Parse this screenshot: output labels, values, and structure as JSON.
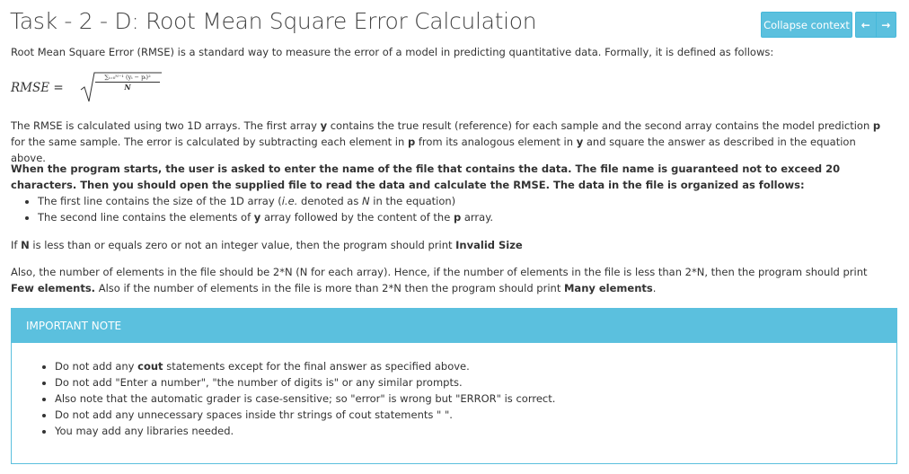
{
  "header": {
    "title": "Task - 2 - D: Root Mean Square Error Calculation",
    "collapse_label": "Collapse context",
    "prev_icon": "←",
    "next_icon": "→"
  },
  "intro": "Root Mean Square Error (RMSE) is a standard way to measure the error of a model in predicting quantitative data. Formally, it is defined as follows:",
  "formula": {
    "lhs": "RMSE =",
    "numerator": "∑ᵢ₌₀ᴺ⁻¹ (yᵢ − pᵢ)²",
    "denominator": "N"
  },
  "description": {
    "p1": "The RMSE is calculated using two 1D arrays. The first array ",
    "y1": "y",
    "p2": " contains the true result (reference) for each sample and the second array contains the model prediction ",
    "p_label": "p",
    "p3": " for the same sample. The error is calculated by subtracting each element in ",
    "p_label2": "p",
    "p4": " from its analogous element in ",
    "y2": "y",
    "p5": " and square the answer as described in the equation above."
  },
  "instructions": "When the program starts, the user is asked to enter the name of the file that contains the data. The file name is guaranteed not to exceed 20 characters. Then you should open the supplied file to read the data and calculate the RMSE. The data in the file is organized as follows:",
  "bullets": {
    "b1_a": "The first line contains the size of the 1D array (",
    "b1_ie": "i.e.",
    "b1_b": " denoted as ",
    "b1_n": "N",
    "b1_c": " in the equation)",
    "b2_a": "The second line contains the elements of ",
    "b2_y": "y",
    "b2_b": " array followed by the content of the ",
    "b2_p": "p",
    "b2_c": " array."
  },
  "invalid": {
    "a": "If ",
    "n": "N",
    "b": " is less than or equals zero or not an integer value, then the program should print ",
    "msg": "Invalid Size"
  },
  "also": {
    "a": "Also, the number of elements in the file should be 2*N (N for each array). Hence, if the number of elements in the file is less than 2*N, then the program should print ",
    "few": "Few elements.",
    "b": " Also if the number of elements in the file is more than 2*N then the program should print ",
    "many": "Many elements",
    "c": "."
  },
  "note": {
    "heading": "Important Note",
    "n1_a": "Do not add any ",
    "n1_cout": "cout",
    "n1_b": " statements except for the final answer as specified above.",
    "n2": "Do not add \"Enter a number\", \"the number of digits is\" or any similar prompts.",
    "n3": "Also note that the automatic grader is case-sensitive; so \"error\" is wrong but \"ERROR\" is correct.",
    "n4": "Do not add any unnecessary spaces inside thr strings of cout statements \" \".",
    "n5": "You may add any libraries needed."
  },
  "colors": {
    "accent": "#5bc0de",
    "text": "#333333"
  }
}
